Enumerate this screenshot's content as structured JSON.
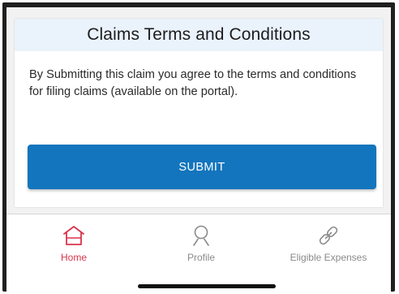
{
  "terms_card": {
    "title": "Claims Terms and Conditions",
    "body": "By Submitting this claim you agree to the terms and conditions for filing claims (available on the portal).",
    "submit_label": "SUBMIT"
  },
  "tab_bar": {
    "items": [
      {
        "label": "Home",
        "icon": "home-icon",
        "active": true
      },
      {
        "label": "Profile",
        "icon": "profile-icon",
        "active": false
      },
      {
        "label": "Eligible Expenses",
        "icon": "link-icon",
        "active": false
      }
    ]
  },
  "colors": {
    "accent": "#1375bd",
    "header_background": "#eaf2fb",
    "active_tab": "#d9334a",
    "inactive_tab": "#8a8a8a"
  }
}
